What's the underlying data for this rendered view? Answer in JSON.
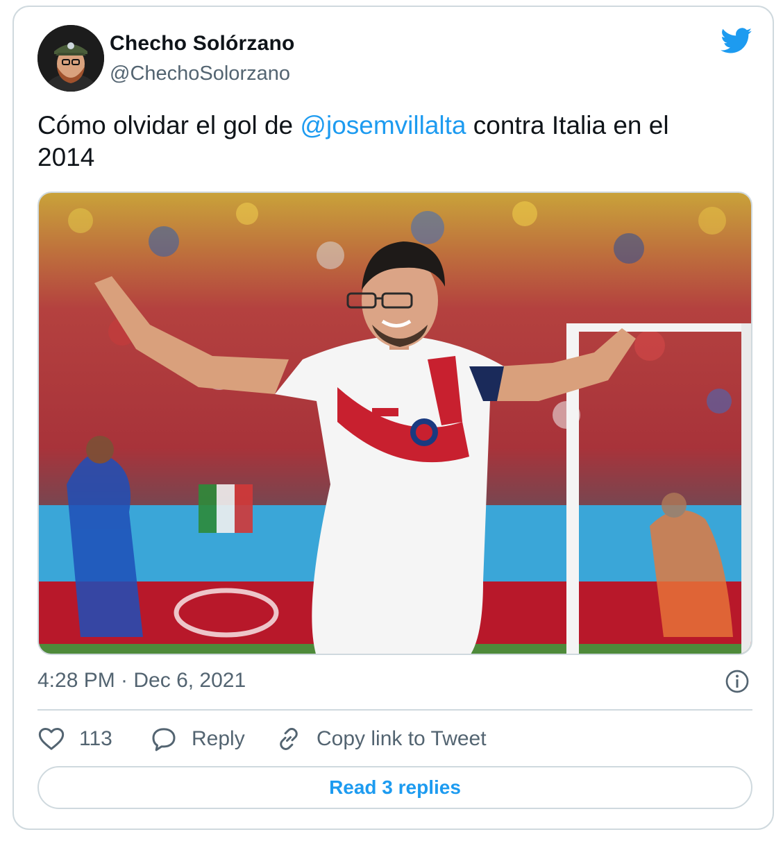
{
  "tweet": {
    "author": {
      "name": "Checho Solórzano",
      "handle": "@ChechoSolorzano"
    },
    "text": {
      "before": "Cómo olvidar el gol de ",
      "mention": "@josemvillalta",
      "after": " contra Italia en el 2014"
    },
    "timestamp": "4:28 PM · Dec 6, 2021",
    "likes_count": "113",
    "reply_label": "Reply",
    "copy_link_label": "Copy link to Tweet",
    "read_replies_label": "Read 3 replies"
  },
  "icons": {
    "brand": "twitter-bird-icon",
    "like": "heart-icon",
    "reply": "speech-bubble-icon",
    "copy": "link-icon",
    "info": "info-icon"
  },
  "colors": {
    "accent": "#1d9bf0",
    "text": "#0f1419",
    "muted": "#536471",
    "border": "#cfd9de",
    "jersey_red": "#c8202f",
    "pitch_blue": "#3aa6d8"
  }
}
